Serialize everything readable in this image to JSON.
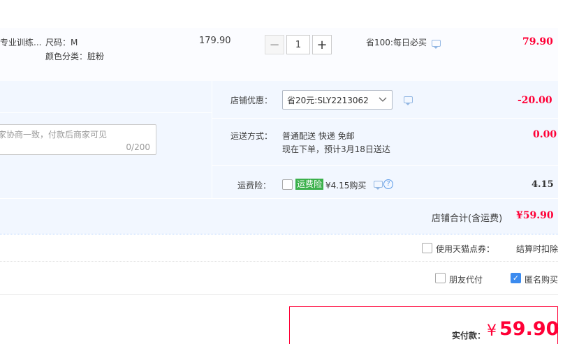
{
  "item": {
    "title": "专业训练...",
    "size": "尺码：M",
    "color": "颜色分类：脏粉",
    "unit_price": "179.90",
    "quantity": "1",
    "minus": "−",
    "plus": "+",
    "promo": "省100:每日必买",
    "subtotal": "79.90"
  },
  "shop": {
    "coupon_label": "店铺优惠：",
    "coupon_value": "省20元:SLY2213062",
    "coupon_amount": "-20.00",
    "note_placeholder": "家协商一致，付款后商家可见",
    "note_count": "0/200",
    "shipping_label": "运送方式：",
    "shipping_method": "普通配送 快递 免邮",
    "shipping_eta": "现在下单，预计3月18日送达",
    "shipping_amount": "0.00",
    "insurance_label": "运费险：",
    "insurance_badge": "运费险",
    "insurance_price": "¥4.15购买",
    "insurance_amount": "4.15",
    "total_label": "店铺合计(含运费)",
    "total_value": "¥59.90"
  },
  "options": {
    "tmall_points_label": "使用天猫点券：",
    "tmall_points_value": "结算时扣除",
    "friend_pay_label": "朋友代付",
    "anonymous_label": "匿名购买"
  },
  "payment": {
    "label": "实付款：",
    "currency": "¥",
    "amount": "59.90"
  },
  "colors": {
    "accent_red": "#ff0036",
    "panel_blue": "#f2f7ff",
    "badge_green": "#3bb04b",
    "check_blue": "#3b8bef"
  }
}
